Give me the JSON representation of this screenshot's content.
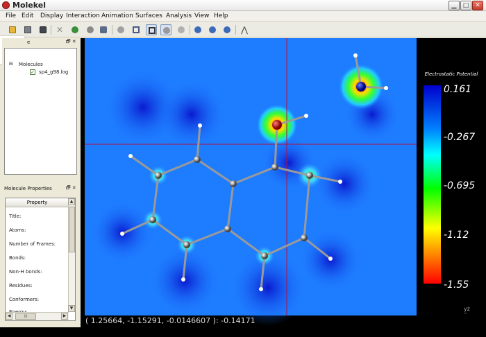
{
  "window": {
    "title": "Molekel",
    "min": "▁",
    "max": "□",
    "close": "✕"
  },
  "menu": [
    "File",
    "Edit",
    "Display",
    "Interaction",
    "Animation",
    "Surfaces",
    "Analysis",
    "View",
    "Help"
  ],
  "toolbar": {
    "icons": [
      "open-icon",
      "save-icon",
      "snapshot-icon",
      "delete-icon",
      "rotate-icon",
      "sphere-icon",
      "atoms-icon",
      "molecule-icon",
      "bond-icon",
      "grid-icon",
      "select-icon",
      "select-rect-icon",
      "move-icon",
      "play-icon",
      "pause-icon",
      "stop-icon",
      "measure-icon"
    ]
  },
  "back_overlay": {
    "glyph": "<"
  },
  "molecules_panel": {
    "title": "e",
    "controls": "🗗 ✕",
    "tree_root": "Molecules",
    "tree_item": "sp4_g98.log",
    "tree_expander": "⊟"
  },
  "properties_panel": {
    "title": "Molecule Properties",
    "controls": "🗗 ✕",
    "header": "Property",
    "rows": [
      "Title:",
      "Atoms:",
      "Number of Frames:",
      "Bonds:",
      "Non-H bonds:",
      "Residues:",
      "Conformers:",
      "Energy:"
    ],
    "arrows": {
      "up": "▲",
      "down": "▼",
      "left": "◀",
      "right": "▶"
    },
    "hthumb": "III"
  },
  "colorbar": {
    "title": "Electrostatic Potential",
    "labels": [
      "0.161",
      "-0.267",
      "-0.695",
      "-1.12",
      "-1.55"
    ],
    "colors": [
      "#0000cc",
      "#00ffff",
      "#00ff00",
      "#ffff00",
      "#ff0000"
    ]
  },
  "status": {
    "coordinates": "( 1.25664, -1.15291, -0.0146607 ): -0.14171"
  },
  "axes_label": "y̲z"
}
